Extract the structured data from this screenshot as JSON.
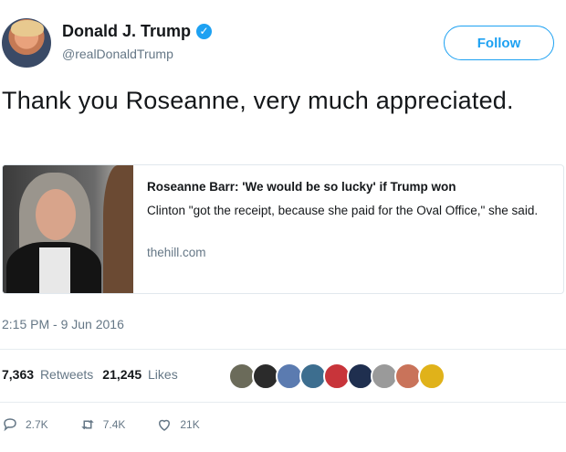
{
  "author": {
    "name": "Donald J. Trump",
    "handle": "@realDonaldTrump",
    "verified_mark": "✓"
  },
  "follow_button": {
    "label": "Follow"
  },
  "tweet": {
    "text": "Thank you Roseanne, very much appreciated."
  },
  "card": {
    "title": "Roseanne Barr: 'We would be so lucky' if Trump won",
    "description": "Clinton \"got the receipt, because she paid for the Oval Office,\" she said.",
    "domain": "thehill.com"
  },
  "timestamp": "2:15 PM - 9 Jun 2016",
  "stats": {
    "retweets_count": "7,363",
    "retweets_label": "Retweets",
    "likes_count": "21,245",
    "likes_label": "Likes"
  },
  "likers": [
    {
      "name": "liker-avatar-1",
      "color": "#6b6b5a"
    },
    {
      "name": "liker-avatar-2",
      "color": "#2b2b2b"
    },
    {
      "name": "liker-avatar-3",
      "color": "#5b7bb0"
    },
    {
      "name": "liker-avatar-4",
      "color": "#3d6e8f"
    },
    {
      "name": "liker-avatar-5",
      "color": "#c8343a"
    },
    {
      "name": "liker-avatar-6",
      "color": "#1f2f4f"
    },
    {
      "name": "liker-avatar-7",
      "color": "#9a9a9a"
    },
    {
      "name": "liker-avatar-8",
      "color": "#c9735a"
    },
    {
      "name": "liker-avatar-9",
      "color": "#e0b21a"
    }
  ],
  "actions": {
    "replies": "2.7K",
    "retweets": "7.4K",
    "likes": "21K"
  },
  "colors": {
    "accent": "#1da1f2",
    "secondary_text": "#657786"
  }
}
